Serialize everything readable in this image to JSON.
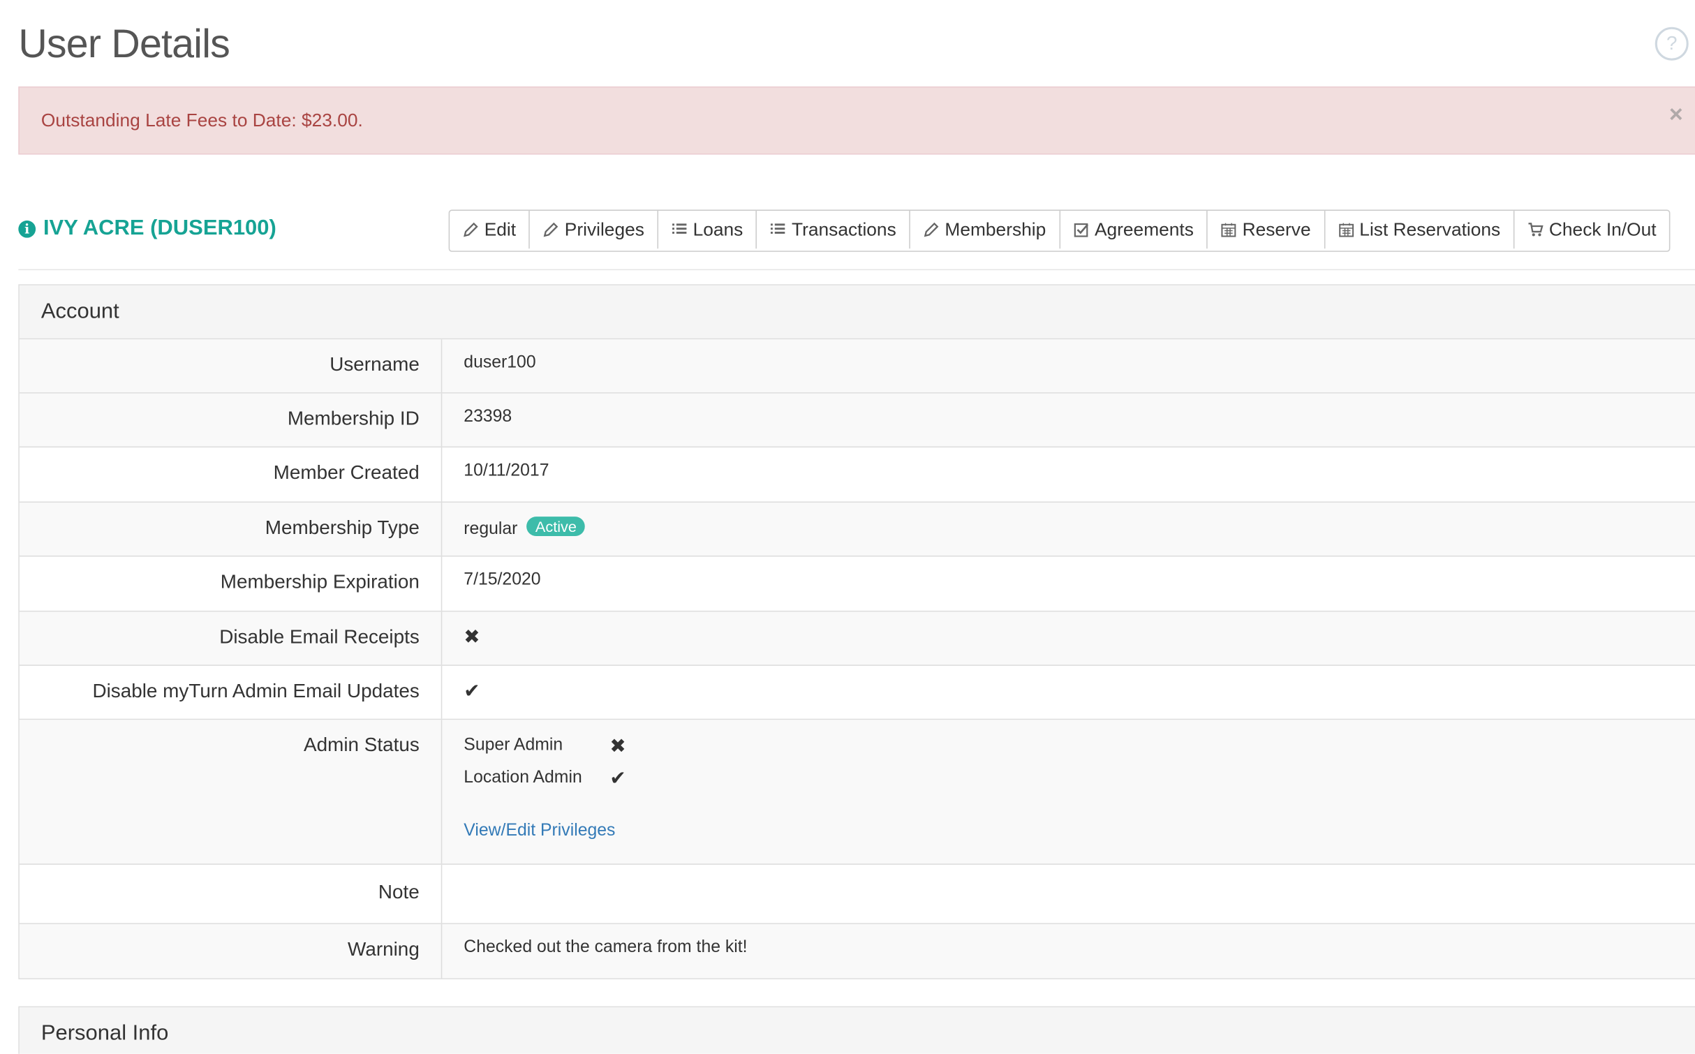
{
  "page": {
    "title": "User Details",
    "help_icon": "question-circle-icon"
  },
  "alert": {
    "text": "Outstanding Late Fees to Date: $23.00.",
    "close": "×"
  },
  "user": {
    "name": "IVY ACRE (DUSER100)",
    "icon": "info-circle-icon",
    "icon_glyph": "i"
  },
  "toolbar": {
    "buttons": [
      {
        "label": "Edit",
        "icon": "pencil-icon"
      },
      {
        "label": "Privileges",
        "icon": "pencil-icon"
      },
      {
        "label": "Loans",
        "icon": "list-icon"
      },
      {
        "label": "Transactions",
        "icon": "list-icon"
      },
      {
        "label": "Membership",
        "icon": "pencil-icon"
      },
      {
        "label": "Agreements",
        "icon": "check-square-icon"
      },
      {
        "label": "Reserve",
        "icon": "calendar-icon"
      },
      {
        "label": "List Reservations",
        "icon": "calendar-icon"
      },
      {
        "label": "Check In/Out",
        "icon": "cart-icon"
      }
    ]
  },
  "account": {
    "heading": "Account",
    "rows": [
      {
        "label": "Username",
        "value": "duser100"
      },
      {
        "label": "Membership ID",
        "value": "23398"
      },
      {
        "label": "Member Created",
        "value": "10/11/2017"
      },
      {
        "label": "Membership Type",
        "value": "regular",
        "badge": "Active"
      },
      {
        "label": "Membership Expiration",
        "value": "7/15/2020"
      },
      {
        "label": "Disable Email Receipts",
        "value": "✖"
      },
      {
        "label": "Disable myTurn Admin Email Updates",
        "value": "✔"
      },
      {
        "label": "Admin Status",
        "super_admin_label": "Super Admin",
        "super_admin_value": "✖",
        "location_admin_label": "Location Admin",
        "location_admin_value": "✔",
        "link": "View/Edit Privileges"
      },
      {
        "label": "Note",
        "value": ""
      },
      {
        "label": "Warning",
        "value": "Checked out the camera from the kit!"
      }
    ]
  },
  "personal": {
    "heading": "Personal Info"
  },
  "colors": {
    "brand": "#16a394",
    "badge": "#3dbcaa",
    "alert_bg": "#f2dede",
    "alert_text": "#a94442",
    "link": "#337ab7"
  }
}
